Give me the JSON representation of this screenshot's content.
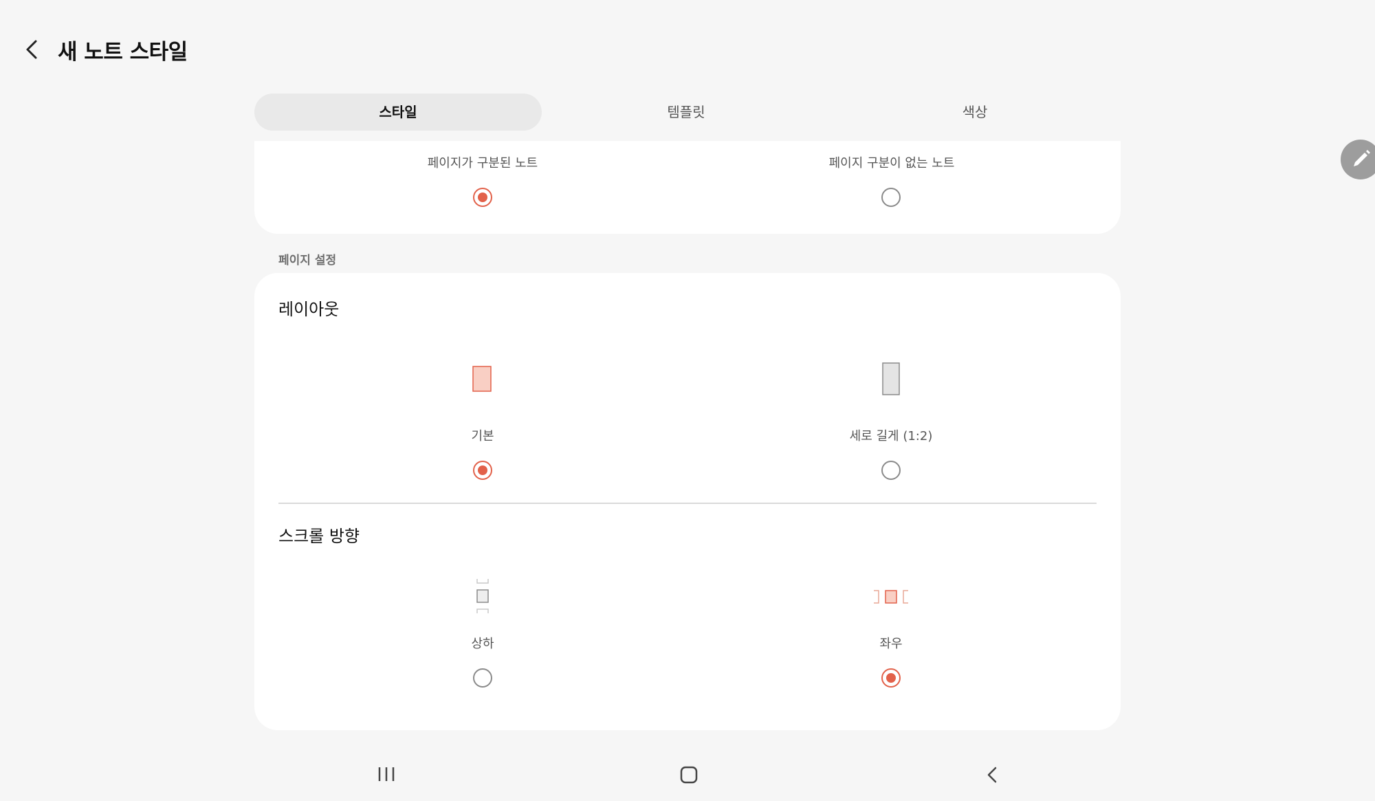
{
  "header": {
    "title": "새 노트 스타일"
  },
  "tabs": [
    {
      "label": "스타일",
      "active": true
    },
    {
      "label": "템플릿",
      "active": false
    },
    {
      "label": "색상",
      "active": false
    }
  ],
  "note_type": {
    "options": [
      {
        "label": "페이지가 구분된 노트",
        "selected": true
      },
      {
        "label": "페이지 구분이 없는 노트",
        "selected": false
      }
    ]
  },
  "page_settings": {
    "section_label": "페이지 설정",
    "layout": {
      "title": "레이아웃",
      "options": [
        {
          "label": "기본",
          "icon": "portrait-page-icon",
          "selected": true
        },
        {
          "label": "세로 길게 (1:2)",
          "icon": "tall-page-icon",
          "selected": false
        }
      ]
    },
    "scroll": {
      "title": "스크롤 방향",
      "options": [
        {
          "label": "상하",
          "icon": "vertical-scroll-icon",
          "selected": false
        },
        {
          "label": "좌우",
          "icon": "horizontal-scroll-icon",
          "selected": true
        }
      ]
    }
  },
  "colors": {
    "accent": "#e2614a",
    "accent_fill": "#f9cfc4",
    "background": "#f6f6f6",
    "card": "#ffffff"
  },
  "nav_icons": [
    "recent-apps-icon",
    "home-icon",
    "back-icon"
  ]
}
